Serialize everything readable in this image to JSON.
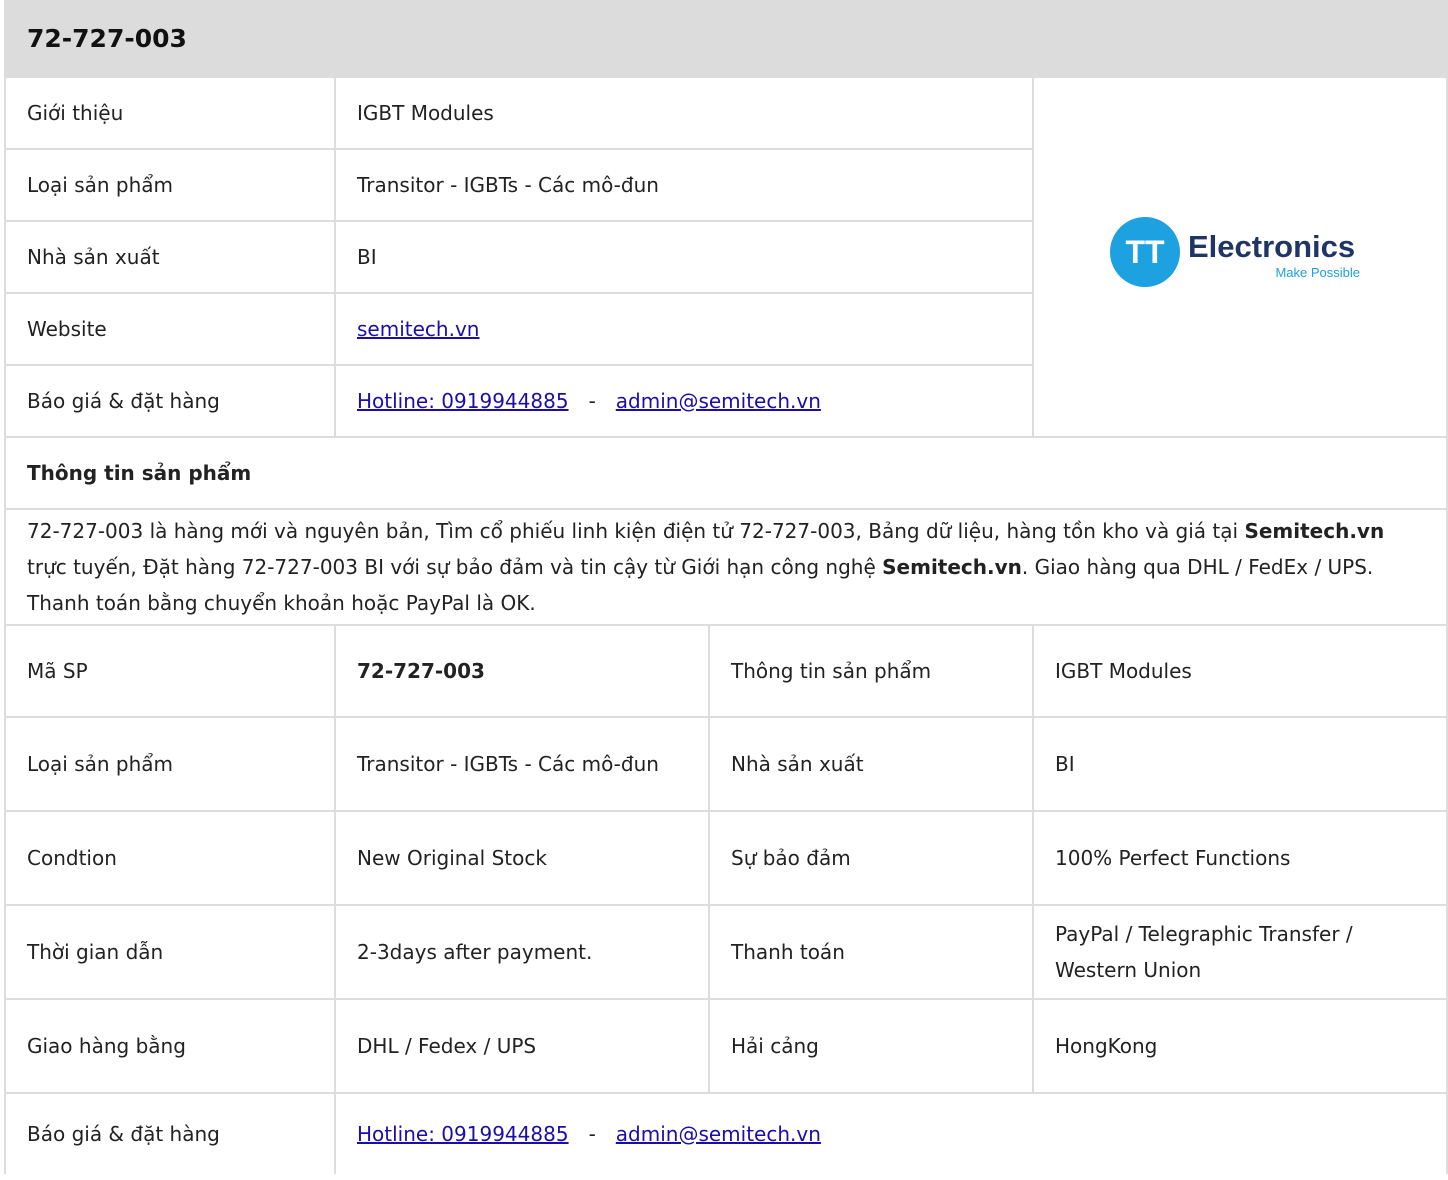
{
  "title": "72-727-003",
  "top": {
    "rows": [
      {
        "label": "Giới thiệu",
        "value": "IGBT Modules"
      },
      {
        "label": "Loại sản phẩm",
        "value": "Transitor - IGBTs - Các mô-đun"
      },
      {
        "label": "Nhà sản xuất",
        "value": "BI"
      }
    ],
    "website_label": "Website",
    "website_link": "semitech.vn",
    "order_label": "Báo giá & đặt hàng",
    "hotline": "Hotline: 0919944885",
    "separator": "-",
    "email": "admin@semitech.vn"
  },
  "logo": {
    "brand": "Electronics",
    "tagline": "Make Possible",
    "mark": "TT",
    "color_circle": "#1ea1e0",
    "color_text": "#1f3566"
  },
  "info": {
    "heading": "Thông tin sản phẩm",
    "p1": "72-727-003 là hàng mới và nguyên bản, Tìm cổ phiếu linh kiện điện tử 72-727-003, Bảng dữ liệu, hàng tồn kho và giá tại ",
    "brand1": "Semitech.vn",
    "p2": " trực tuyến, Đặt hàng 72-727-003 BI với sự bảo đảm và tin cậy từ Giới hạn công nghệ ",
    "brand2": "Semitech.vn",
    "p3": ". Giao hàng qua DHL / FedEx / UPS. Thanh toán bằng chuyển khoản hoặc PayPal là OK."
  },
  "specs": [
    {
      "k1": "Mã SP",
      "v1": "72-727-003",
      "k2": "Thông tin sản phẩm",
      "v2": "IGBT Modules"
    },
    {
      "k1": "Loại sản phẩm",
      "v1": "Transitor - IGBTs - Các mô-đun",
      "k2": "Nhà sản xuất",
      "v2": "BI"
    },
    {
      "k1": "Condtion",
      "v1": "New Original Stock",
      "k2": "Sự bảo đảm",
      "v2": "100% Perfect Functions"
    },
    {
      "k1": "Thời gian dẫn",
      "v1": "2-3days after payment.",
      "k2": "Thanh toán",
      "v2": "PayPal / Telegraphic Transfer / Western Union"
    },
    {
      "k1": "Giao hàng bằng",
      "v1": "DHL / Fedex / UPS",
      "k2": "Hải cảng",
      "v2": "HongKong"
    }
  ],
  "footer": {
    "label": "Báo giá & đặt hàng",
    "hotline": "Hotline: 0919944885",
    "separator": "-",
    "email": "admin@semitech.vn"
  }
}
